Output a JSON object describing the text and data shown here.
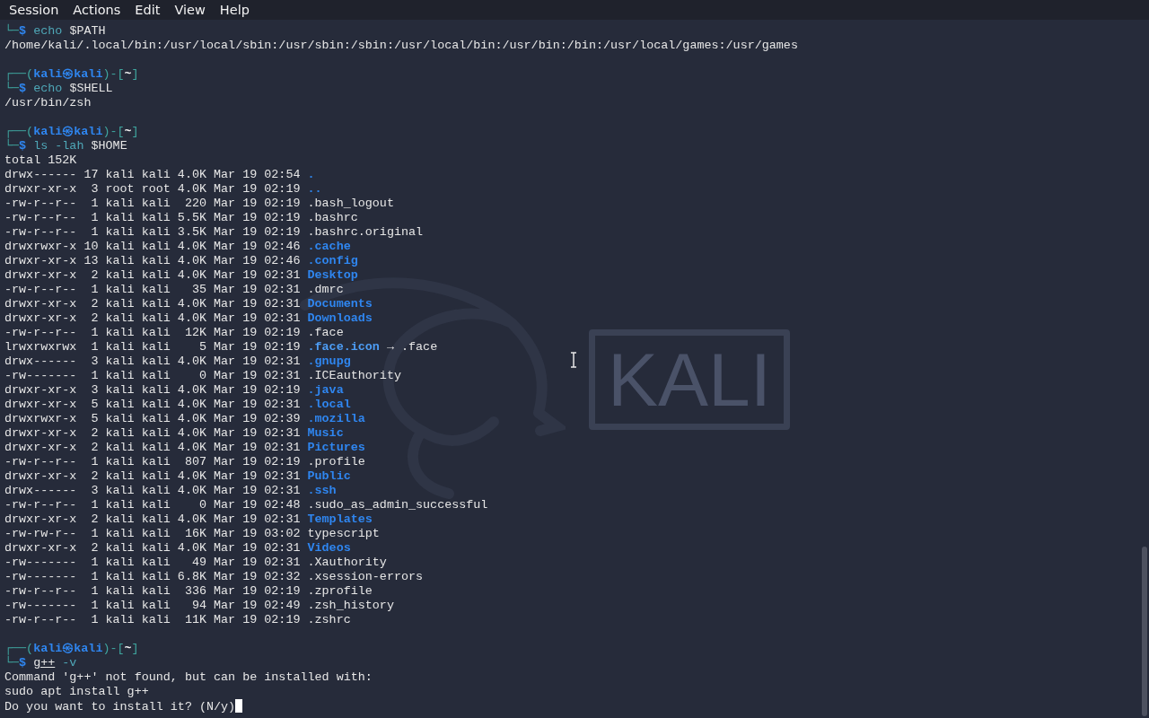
{
  "menu_bar": [
    "Session",
    "Actions",
    "Edit",
    "View",
    "Help"
  ],
  "background_logo": {
    "text": "KALI"
  },
  "terminal": [
    {
      "kind": "command",
      "parts": [
        {
          "kind": "frame",
          "text": "└─"
        },
        {
          "kind": "sigil",
          "text": "$"
        },
        {
          "kind": "command",
          "text": "echo"
        },
        {
          "kind": "word",
          "text": "$PATH"
        }
      ]
    },
    {
      "kind": "output",
      "text": "/home/kali/.local/bin:/usr/local/sbin:/usr/sbin:/sbin:/usr/local/bin:/usr/bin:/bin:/usr/local/games:/usr/games"
    },
    {
      "kind": "blank"
    },
    {
      "kind": "prompt",
      "parts": [
        {
          "kind": "frame",
          "text": "┌──("
        },
        {
          "kind": "identity",
          "text": "kali㉿kali"
        },
        {
          "kind": "frame",
          "text": ")-["
        },
        {
          "kind": "directory",
          "text": "~"
        },
        {
          "kind": "frame",
          "text": "]"
        }
      ]
    },
    {
      "kind": "command",
      "parts": [
        {
          "kind": "frame",
          "text": "└─"
        },
        {
          "kind": "sigil",
          "text": "$"
        },
        {
          "kind": "command",
          "text": "echo"
        },
        {
          "kind": "word",
          "text": "$SHELL"
        }
      ]
    },
    {
      "kind": "output",
      "text": "/usr/bin/zsh"
    },
    {
      "kind": "blank"
    },
    {
      "kind": "prompt",
      "parts": [
        {
          "kind": "frame",
          "text": "┌──("
        },
        {
          "kind": "identity",
          "text": "kali㉿kali"
        },
        {
          "kind": "frame",
          "text": ")-["
        },
        {
          "kind": "directory",
          "text": "~"
        },
        {
          "kind": "frame",
          "text": "]"
        }
      ]
    },
    {
      "kind": "command",
      "parts": [
        {
          "kind": "frame",
          "text": "└─"
        },
        {
          "kind": "sigil",
          "text": "$"
        },
        {
          "kind": "command",
          "text": "ls"
        },
        {
          "kind": "option",
          "text": "-lah"
        },
        {
          "kind": "word",
          "text": "$HOME"
        }
      ]
    },
    {
      "kind": "output",
      "text": "total 152K"
    },
    {
      "kind": "entry",
      "meta": "drwx------ 17 kali kali 4.0K Mar 19 02:54",
      "name": ".",
      "directory": true
    },
    {
      "kind": "entry",
      "meta": "drwxr-xr-x  3 root root 4.0K Mar 19 02:19",
      "name": "..",
      "directory": true
    },
    {
      "kind": "entry",
      "meta": "-rw-r--r--  1 kali kali  220 Mar 19 02:19",
      "name": ".bash_logout",
      "directory": false
    },
    {
      "kind": "entry",
      "meta": "-rw-r--r--  1 kali kali 5.5K Mar 19 02:19",
      "name": ".bashrc",
      "directory": false
    },
    {
      "kind": "entry",
      "meta": "-rw-r--r--  1 kali kali 3.5K Mar 19 02:19",
      "name": ".bashrc.original",
      "directory": false
    },
    {
      "kind": "entry",
      "meta": "drwxrwxr-x 10 kali kali 4.0K Mar 19 02:46",
      "name": ".cache",
      "directory": true
    },
    {
      "kind": "entry",
      "meta": "drwxr-xr-x 13 kali kali 4.0K Mar 19 02:46",
      "name": ".config",
      "directory": true
    },
    {
      "kind": "entry",
      "meta": "drwxr-xr-x  2 kali kali 4.0K Mar 19 02:31",
      "name": "Desktop",
      "directory": true
    },
    {
      "kind": "entry",
      "meta": "-rw-r--r--  1 kali kali   35 Mar 19 02:31",
      "name": ".dmrc",
      "directory": false
    },
    {
      "kind": "entry",
      "meta": "drwxr-xr-x  2 kali kali 4.0K Mar 19 02:31",
      "name": "Documents",
      "directory": true
    },
    {
      "kind": "entry",
      "meta": "drwxr-xr-x  2 kali kali 4.0K Mar 19 02:31",
      "name": "Downloads",
      "directory": true
    },
    {
      "kind": "entry",
      "meta": "-rw-r--r--  1 kali kali  12K Mar 19 02:19",
      "name": ".face",
      "directory": false
    },
    {
      "kind": "entry",
      "meta": "lrwxrwxrwx  1 kali kali    5 Mar 19 02:19",
      "name": ".face.icon",
      "directory": false,
      "target": "→ .face"
    },
    {
      "kind": "entry",
      "meta": "drwx------  3 kali kali 4.0K Mar 19 02:31",
      "name": ".gnupg",
      "directory": true
    },
    {
      "kind": "entry",
      "meta": "-rw-------  1 kali kali    0 Mar 19 02:31",
      "name": ".ICEauthority",
      "directory": false
    },
    {
      "kind": "entry",
      "meta": "drwxr-xr-x  3 kali kali 4.0K Mar 19 02:19",
      "name": ".java",
      "directory": true
    },
    {
      "kind": "entry",
      "meta": "drwxr-xr-x  5 kali kali 4.0K Mar 19 02:31",
      "name": ".local",
      "directory": true
    },
    {
      "kind": "entry",
      "meta": "drwxrwxr-x  5 kali kali 4.0K Mar 19 02:39",
      "name": ".mozilla",
      "directory": true
    },
    {
      "kind": "entry",
      "meta": "drwxr-xr-x  2 kali kali 4.0K Mar 19 02:31",
      "name": "Music",
      "directory": true
    },
    {
      "kind": "entry",
      "meta": "drwxr-xr-x  2 kali kali 4.0K Mar 19 02:31",
      "name": "Pictures",
      "directory": true
    },
    {
      "kind": "entry",
      "meta": "-rw-r--r--  1 kali kali  807 Mar 19 02:19",
      "name": ".profile",
      "directory": false
    },
    {
      "kind": "entry",
      "meta": "drwxr-xr-x  2 kali kali 4.0K Mar 19 02:31",
      "name": "Public",
      "directory": true
    },
    {
      "kind": "entry",
      "meta": "drwx------  3 kali kali 4.0K Mar 19 02:31",
      "name": ".ssh",
      "directory": true
    },
    {
      "kind": "entry",
      "meta": "-rw-r--r--  1 kali kali    0 Mar 19 02:48",
      "name": ".sudo_as_admin_successful",
      "directory": false
    },
    {
      "kind": "entry",
      "meta": "drwxr-xr-x  2 kali kali 4.0K Mar 19 02:31",
      "name": "Templates",
      "directory": true
    },
    {
      "kind": "entry",
      "meta": "-rw-rw-r--  1 kali kali  16K Mar 19 03:02",
      "name": "typescript",
      "directory": false
    },
    {
      "kind": "entry",
      "meta": "drwxr-xr-x  2 kali kali 4.0K Mar 19 02:31",
      "name": "Videos",
      "directory": true
    },
    {
      "kind": "entry",
      "meta": "-rw-------  1 kali kali   49 Mar 19 02:31",
      "name": ".Xauthority",
      "directory": false
    },
    {
      "kind": "entry",
      "meta": "-rw-------  1 kali kali 6.8K Mar 19 02:32",
      "name": ".xsession-errors",
      "directory": false
    },
    {
      "kind": "entry",
      "meta": "-rw-r--r--  1 kali kali  336 Mar 19 02:19",
      "name": ".zprofile",
      "directory": false
    },
    {
      "kind": "entry",
      "meta": "-rw-------  1 kali kali   94 Mar 19 02:49",
      "name": ".zsh_history",
      "directory": false
    },
    {
      "kind": "entry",
      "meta": "-rw-r--r--  1 kali kali  11K Mar 19 02:19",
      "name": ".zshrc",
      "directory": false
    },
    {
      "kind": "blank"
    },
    {
      "kind": "prompt",
      "parts": [
        {
          "kind": "frame",
          "text": "┌──("
        },
        {
          "kind": "identity",
          "text": "kali㉿kali"
        },
        {
          "kind": "frame",
          "text": ")-["
        },
        {
          "kind": "directory",
          "text": "~"
        },
        {
          "kind": "frame",
          "text": "]"
        }
      ]
    },
    {
      "kind": "command",
      "parts": [
        {
          "kind": "frame",
          "text": "└─"
        },
        {
          "kind": "sigil",
          "text": "$"
        },
        {
          "kind": "unknown",
          "text": "g++"
        },
        {
          "kind": "option",
          "text": "-v"
        }
      ]
    },
    {
      "kind": "output",
      "text": "Command 'g++' not found, but can be installed with:"
    },
    {
      "kind": "output",
      "text": "sudo apt install g++"
    },
    {
      "kind": "output",
      "text": "Do you want to install it? (N/y)",
      "cursor": true
    }
  ]
}
